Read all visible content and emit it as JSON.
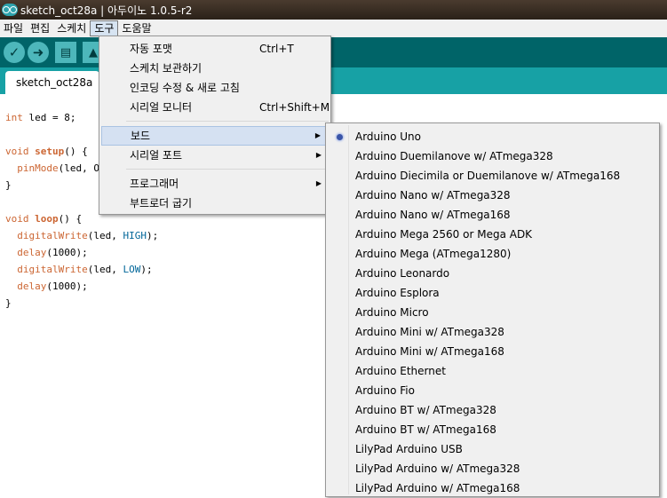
{
  "window": {
    "title": "sketch_oct28a | 아두이노 1.0.5-r2"
  },
  "menubar": [
    "파일",
    "편집",
    "스케치",
    "도구",
    "도움말"
  ],
  "toolbar": {
    "buttons": [
      "verify-icon",
      "upload-icon",
      "new-icon",
      "open-icon"
    ]
  },
  "tab": {
    "label": "sketch_oct28a §"
  },
  "code": {
    "line1": {
      "kw": "int",
      "rest": " led = 8;"
    },
    "line3": {
      "kw": "void",
      "fn": "setup",
      "rest": "() {"
    },
    "line4": {
      "fn": "pinMode",
      "rest": "(led, OUT"
    },
    "line5": "}",
    "line7": {
      "kw": "void",
      "fn": "loop",
      "rest": "() {"
    },
    "line8": {
      "fn": "digitalWrite",
      "a": "(led, ",
      "c": "HIGH",
      "b": ");"
    },
    "line9": {
      "fn": "delay",
      "rest": "(1000);"
    },
    "line10": {
      "fn": "digitalWrite",
      "a": "(led, ",
      "c": "LOW",
      "b": ");"
    },
    "line11": {
      "fn": "delay",
      "rest": "(1000);"
    },
    "line12": "}"
  },
  "tools_menu": {
    "items": [
      {
        "label": "자동 포맷",
        "shortcut": "Ctrl+T"
      },
      {
        "label": "스케치 보관하기",
        "shortcut": ""
      },
      {
        "label": "인코딩 수정 & 새로 고침",
        "shortcut": ""
      },
      {
        "label": "시리얼 모니터",
        "shortcut": "Ctrl+Shift+M"
      },
      {
        "label": "보드",
        "submenu": true
      },
      {
        "label": "시리얼 포트",
        "submenu": true
      },
      {
        "label": "프로그래머",
        "submenu": true
      },
      {
        "label": "부트로더 굽기",
        "submenu": false
      }
    ],
    "arrow": "▶"
  },
  "board_menu": {
    "selected": "Arduino Uno",
    "items": [
      "Arduino Uno",
      "Arduino Duemilanove w/ ATmega328",
      "Arduino Diecimila or Duemilanove w/ ATmega168",
      "Arduino Nano w/ ATmega328",
      "Arduino Nano w/ ATmega168",
      "Arduino Mega 2560 or Mega ADK",
      "Arduino Mega (ATmega1280)",
      "Arduino Leonardo",
      "Arduino Esplora",
      "Arduino Micro",
      "Arduino Mini w/ ATmega328",
      "Arduino Mini w/ ATmega168",
      "Arduino Ethernet",
      "Arduino Fio",
      "Arduino BT w/ ATmega328",
      "Arduino BT w/ ATmega168",
      "LilyPad Arduino USB",
      "LilyPad Arduino w/ ATmega328",
      "LilyPad Arduino w/ ATmega168"
    ]
  }
}
